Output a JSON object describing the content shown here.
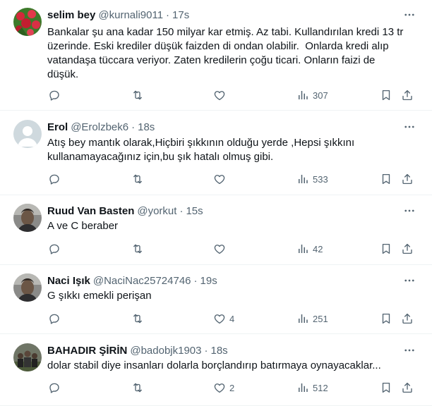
{
  "colors": {
    "text": "#0f1419",
    "secondary": "#536471",
    "border": "#eff3f4"
  },
  "tweets": [
    {
      "name": "selim bey",
      "handle": "@kurnali9011",
      "time": "17s",
      "avatar": "roses-avatar",
      "text": "Bankalar şu ana kadar 150 milyar kar etmiş. Az tabi. Kullandırılan kredi 13 tr\nüzerinde. Eski krediler düşük faizden di ondan olabilir.  Onlarda kredi alıp\nvatandaşa tüccara veriyor. Zaten kredilerin çoğu ticari. Onların faizi de\ndüşük.",
      "replies": "",
      "retweets": "",
      "likes": "",
      "views": "307"
    },
    {
      "name": "Erol",
      "handle": "@Erolzbek6",
      "time": "18s",
      "avatar": "default-avatar",
      "text": "Atış bey mantık olarak,Hiçbiri şıkkının olduğu yerde ,Hepsi şıkkını\nkullanamayacağınız için,bu şık hatalı olmuş gibi.",
      "replies": "",
      "retweets": "",
      "likes": "",
      "views": "533"
    },
    {
      "name": "Ruud Van Basten",
      "handle": "@yorkut",
      "time": "15s",
      "avatar": "photo-avatar",
      "text": "A ve C beraber",
      "replies": "",
      "retweets": "",
      "likes": "",
      "views": "42"
    },
    {
      "name": "Naci Işık",
      "handle": "@NaciNac25724746",
      "time": "19s",
      "avatar": "photo-avatar",
      "text": "G şıkkı emekli perişan",
      "replies": "",
      "retweets": "",
      "likes": "4",
      "views": "251"
    },
    {
      "name": "BAHADIR ŞİRİN",
      "handle": "@badobjk1903",
      "time": "18s",
      "avatar": "group-photo-avatar",
      "text": "dolar stabil diye insanları dolarla borçlandırıp batırmaya oynayacaklar...",
      "replies": "",
      "retweets": "",
      "likes": "2",
      "views": "512"
    }
  ],
  "separator": "·"
}
